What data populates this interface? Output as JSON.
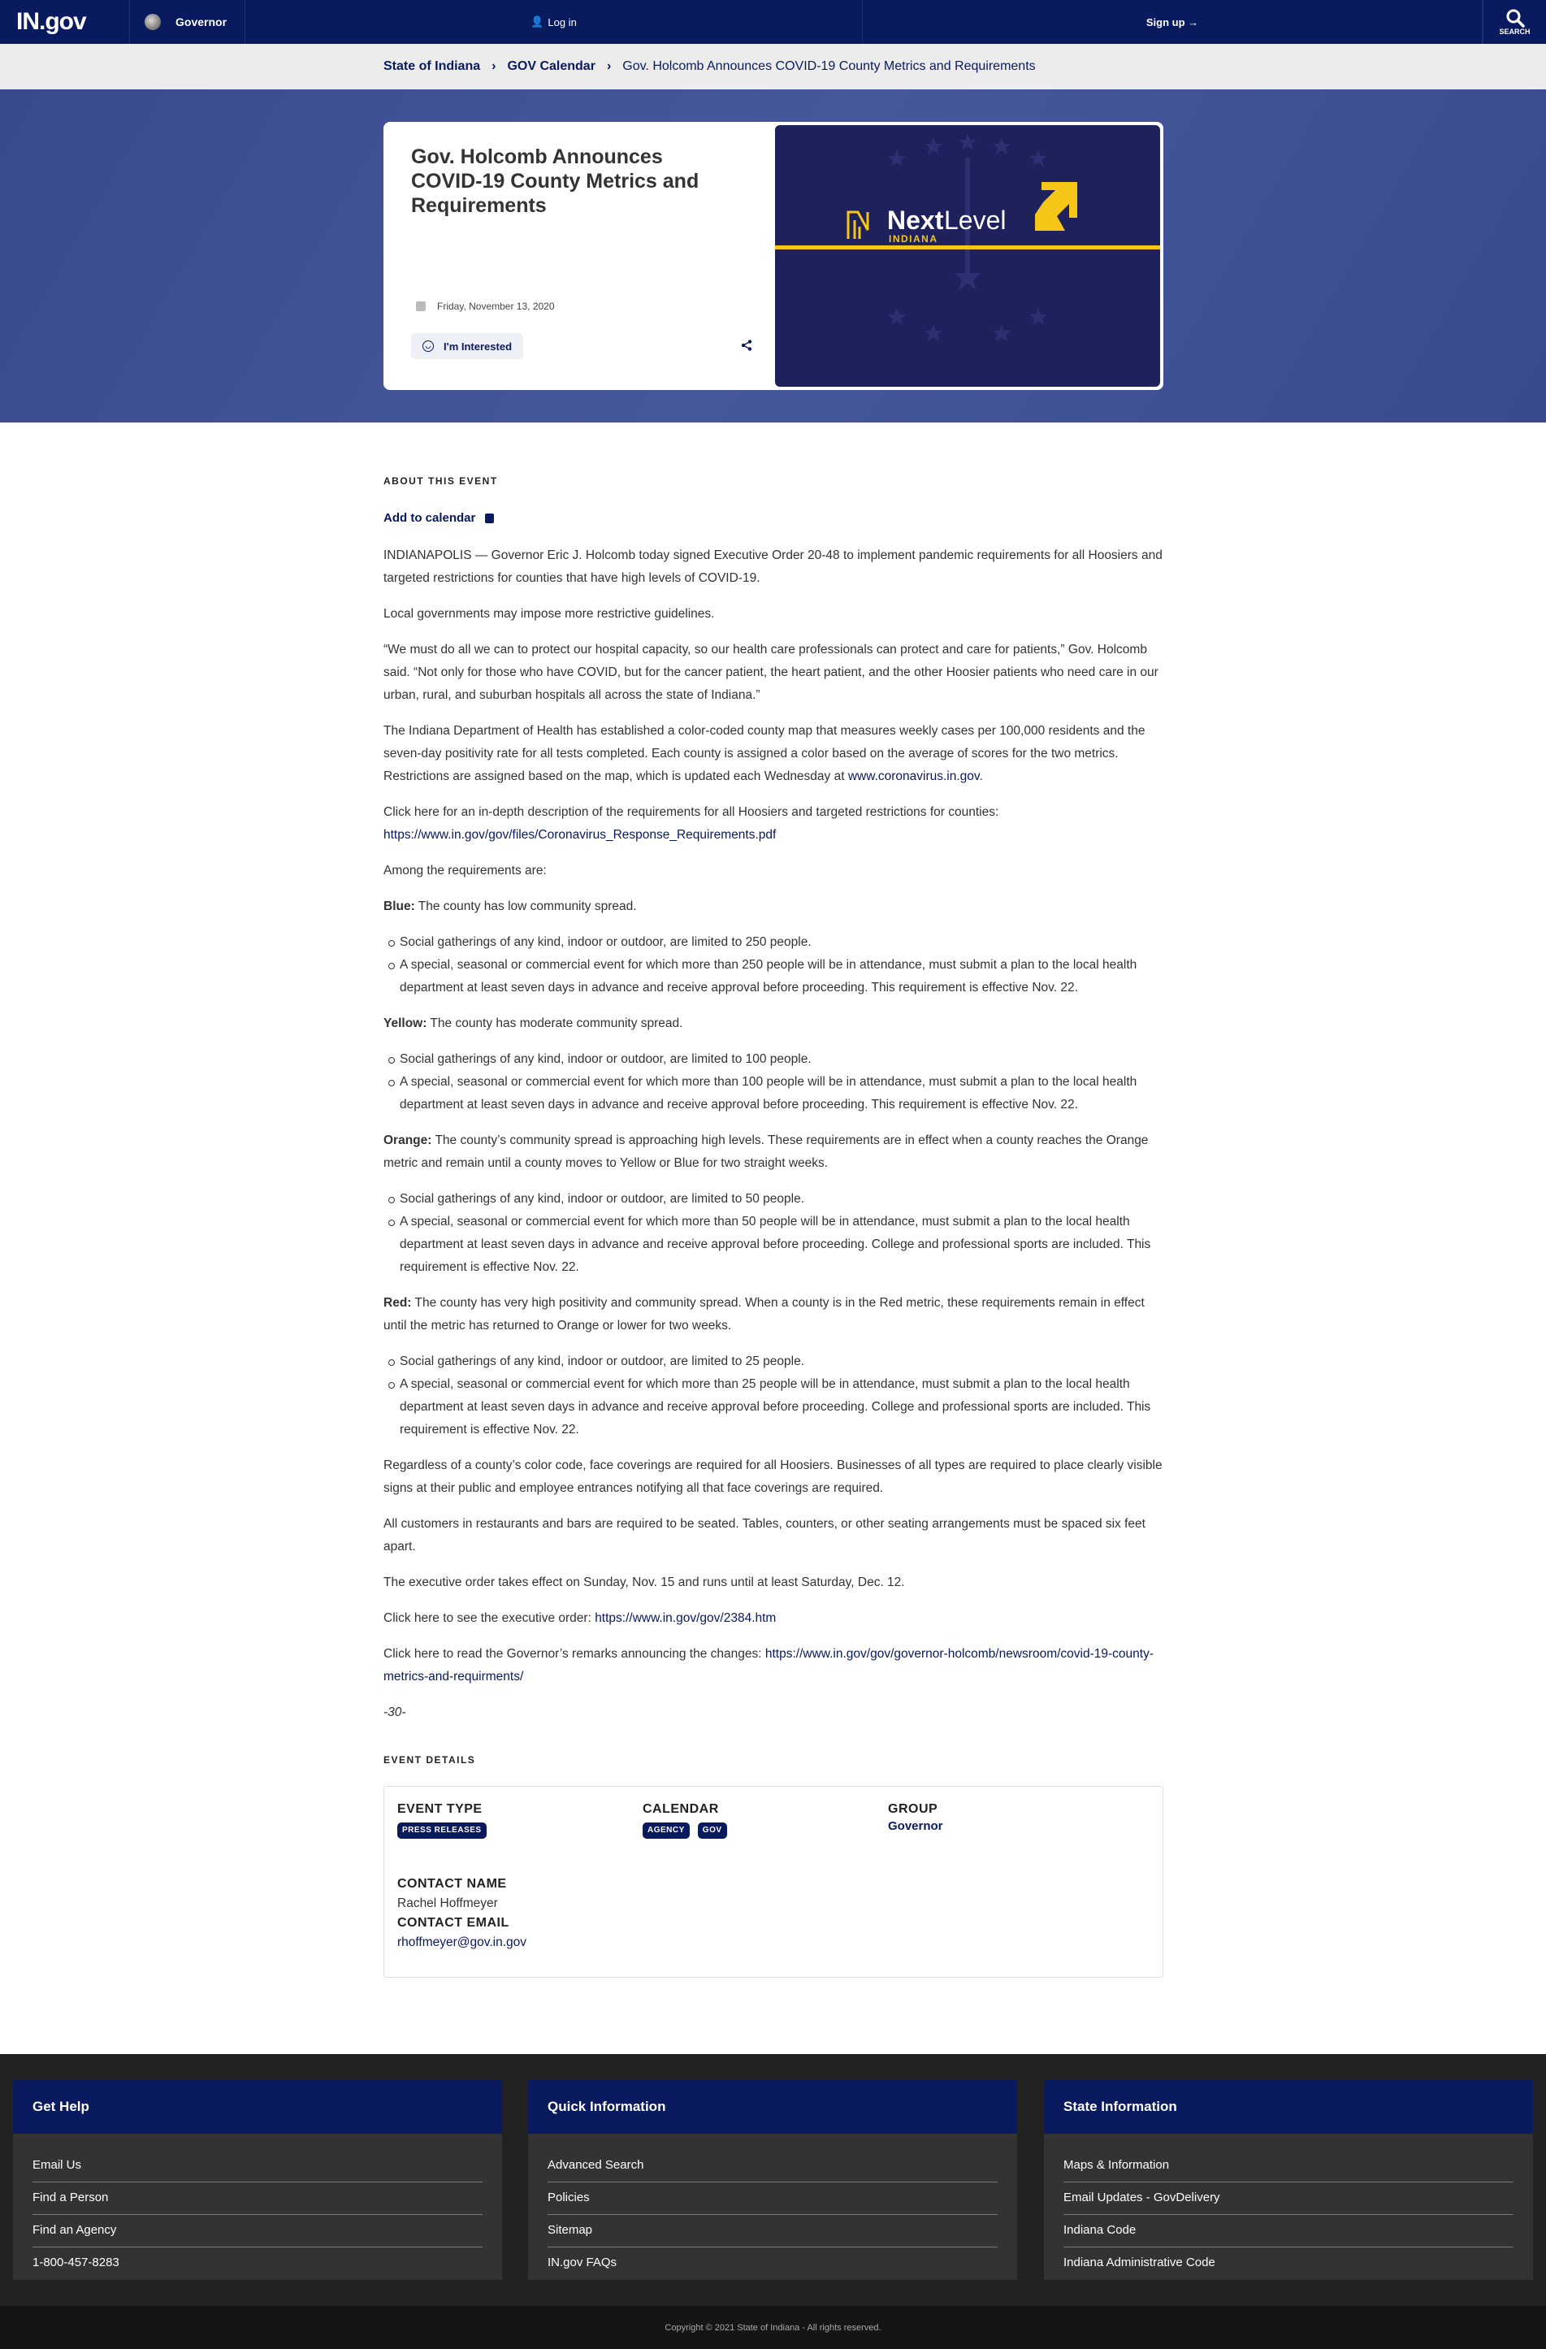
{
  "topnav": {
    "logo": "IN.gov",
    "agency": "Governor",
    "login": "Log in",
    "signup": "Sign up →",
    "search": "SEARCH"
  },
  "breadcrumb": [
    "State of Indiana",
    "GOV Calendar",
    "Gov. Holcomb Announces COVID-19 County Metrics and Requirements"
  ],
  "hero": {
    "title": "Gov. Holcomb Announces COVID-19 County Metrics and Requirements",
    "date": "Friday, November 13, 2020",
    "interested": "I'm Interested",
    "image": {
      "brand_next": "Next",
      "brand_level": "Level",
      "brand_state": "INDIANA",
      "colors": {
        "bg": "#1e215c",
        "accent": "#f5c518"
      }
    }
  },
  "about": {
    "label": "ABOUT THIS EVENT",
    "add_to_calendar": "Add to calendar",
    "p1": "INDIANAPOLIS — Governor Eric J. Holcomb today signed Executive Order 20-48 to implement pandemic requirements for all Hoosiers and targeted restrictions for counties that have high levels of COVID-19.",
    "p2": "Local governments may impose more restrictive guidelines.",
    "p3": "“We must do all we can to protect our hospital capacity, so our health care professionals can protect and care for patients,” Gov. Holcomb said. “Not only for those who have COVID, but for the cancer patient, the heart patient, and the other Hoosier patients who need care in our urban, rural, and suburban hospitals all across the state of Indiana.”",
    "p4_text": "The Indiana Department of Health has established a color-coded county map that measures weekly cases per 100,000 residents and the seven-day positivity rate for all tests completed. Each county is assigned a color based on the average of scores for the two metrics. Restrictions are assigned based on the map, which is updated each Wednesday at ",
    "p4_link": "www.coronavirus.in.gov",
    "p5_text": "Click here for an in-depth description of the requirements for all Hoosiers and targeted restrictions for counties: ",
    "p5_link": "https://www.in.gov/gov/files/Coronavirus_Response_Requirements.pdf",
    "p6": "Among the requirements are:",
    "blue_label": "Blue:",
    "blue_text": " The county has low community spread.",
    "blue_items": [
      "Social gatherings of any kind, indoor or outdoor, are limited to 250 people.",
      "A special, seasonal or commercial event for which more than 250 people will be in attendance, must submit a plan to the local health department at least seven days in advance and receive approval before proceeding. This requirement is effective Nov. 22."
    ],
    "yellow_label": "Yellow:",
    "yellow_text": " The county has moderate community spread.",
    "yellow_items": [
      "Social gatherings of any kind, indoor or outdoor, are limited to 100 people.",
      "A special, seasonal or commercial event for which more than 100 people will be in attendance, must submit a plan to the local health department at least seven days in advance and receive approval before proceeding. This requirement is effective Nov. 22."
    ],
    "orange_label": "Orange:",
    "orange_text": " The county’s community spread is approaching high levels. These requirements are in effect when a county reaches the Orange metric and remain until a county moves to Yellow or Blue for two straight weeks.",
    "orange_items": [
      "Social gatherings of any kind, indoor or outdoor, are limited to 50 people.",
      "A special, seasonal or commercial event for which more than 50 people will be in attendance, must submit a plan to the local health department at least seven days in advance and receive approval before proceeding. College and professional sports are included. This requirement is effective Nov. 22."
    ],
    "red_label": "Red:",
    "red_text": " The county has very high positivity and community spread. When a county is in the Red metric, these requirements remain in effect until the metric has returned to Orange or lower for two weeks.",
    "red_items": [
      "Social gatherings of any kind, indoor or outdoor, are limited to 25 people.",
      "A special, seasonal or commercial event for which more than 25 people will be in attendance, must submit a plan to the local health department at least seven days in advance and receive approval before proceeding. College and professional sports are included. This requirement is effective Nov. 22."
    ],
    "p7": "Regardless of a county’s color code, face coverings are required for all Hoosiers. Businesses of all types are required to place clearly visible signs at their public and employee entrances notifying all that face coverings are required.",
    "p8": "All customers in restaurants and bars are required to be seated. Tables, counters, or other seating arrangements must be spaced six feet apart.",
    "p9": "The executive order takes effect on Sunday, Nov. 15 and runs until at least Saturday, Dec. 12.",
    "p10_text": "Click here to see the executive order: ",
    "p10_link": "https://www.in.gov/gov/2384.htm",
    "p11_text": "Click here to read the Governor’s remarks announcing the changes: ",
    "p11_link": "https://www.in.gov/gov/governor-holcomb/newsroom/covid-19-county-metrics-and-requirments/",
    "end": "-30-"
  },
  "details": {
    "label": "EVENT DETAILS",
    "event_type_head": "EVENT TYPE",
    "event_type_badge": "PRESS RELEASES",
    "calendar_head": "CALENDAR",
    "calendar_badges": [
      "AGENCY",
      "GOV"
    ],
    "group_head": "GROUP",
    "group_value": "Governor",
    "contact_name_head": "CONTACT NAME",
    "contact_name": "Rachel Hoffmeyer",
    "contact_email_head": "CONTACT EMAIL",
    "contact_email": "rhoffmeyer@gov.in.gov"
  },
  "footer": {
    "columns": [
      {
        "title": "Get Help",
        "links": [
          "Email Us",
          "Find a Person",
          "Find an Agency",
          "1-800-457-8283"
        ]
      },
      {
        "title": "Quick Information",
        "links": [
          "Advanced Search",
          "Policies",
          "Sitemap",
          "IN.gov FAQs"
        ]
      },
      {
        "title": "State Information",
        "links": [
          "Maps & Information",
          "Email Updates - GovDelivery",
          "Indiana Code",
          "Indiana Administrative Code"
        ]
      }
    ],
    "copyright": "Copyright © 2021 State of Indiana - All rights reserved."
  },
  "colors": {
    "brand_navy": "#0a1a5e",
    "footer_bg": "#222222"
  }
}
